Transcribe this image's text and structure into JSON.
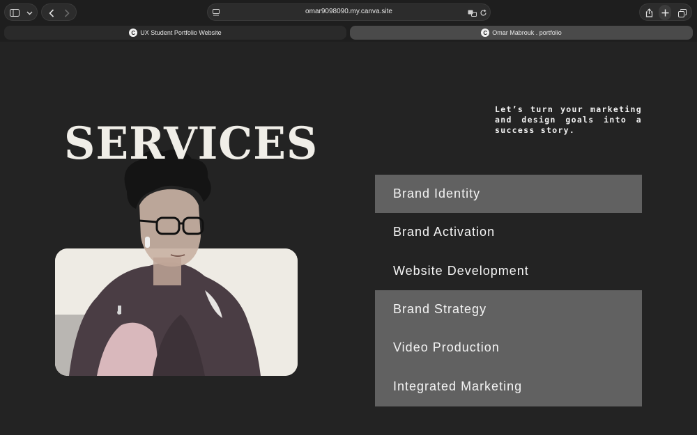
{
  "browser": {
    "url": "omar9098090.my.canva.site",
    "tabs": [
      {
        "label": "UX Student Portfolio Website"
      },
      {
        "label": "Omar Mabrouk . portfolio"
      }
    ]
  },
  "page": {
    "heading": "SERVICES",
    "tagline": "Let’s turn your marketing and design goals into a success story.",
    "services": [
      {
        "label": "Brand Identity"
      },
      {
        "label": "Brand Activation"
      },
      {
        "label": "Website Development"
      },
      {
        "label": "Brand Strategy"
      },
      {
        "label": "Video Production"
      },
      {
        "label": "Integrated Marketing"
      }
    ]
  },
  "colors": {
    "page_bg": "#232323",
    "highlight_bg": "#616161",
    "text": "#f4f4f4"
  }
}
